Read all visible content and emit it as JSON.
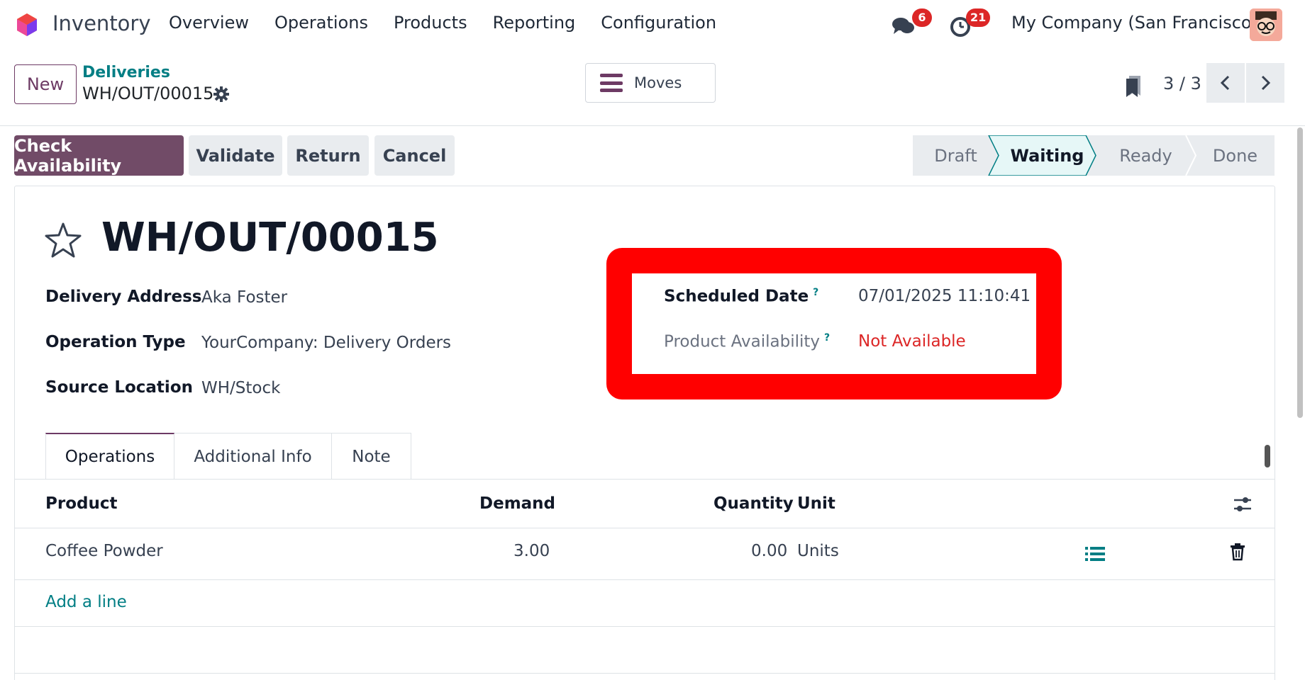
{
  "navbar": {
    "app_name": "Inventory",
    "menu": [
      "Overview",
      "Operations",
      "Products",
      "Reporting",
      "Configuration"
    ],
    "messages_badge": "6",
    "activities_badge": "21",
    "company": "My Company (San Francisco)"
  },
  "control_panel": {
    "new_label": "New",
    "breadcrumb_parent": "Deliveries",
    "breadcrumb_current": "WH/OUT/00015",
    "moves_label": "Moves",
    "pager": "3 / 3"
  },
  "actions": {
    "check_availability": "Check Availability",
    "validate": "Validate",
    "return": "Return",
    "cancel": "Cancel"
  },
  "status_stages": [
    "Draft",
    "Waiting",
    "Ready",
    "Done"
  ],
  "active_stage": "Waiting",
  "record": {
    "title": "WH/OUT/00015",
    "fields": [
      {
        "label": "Delivery Address",
        "value": "Aka Foster"
      },
      {
        "label": "Operation Type",
        "value": "YourCompany: Delivery Orders"
      },
      {
        "label": "Source Location",
        "value": "WH/Stock"
      }
    ],
    "scheduled_date_label": "Scheduled Date",
    "scheduled_date_value": "07/01/2025 11:10:41",
    "availability_label": "Product Availability",
    "availability_value": "Not Available",
    "help_mark": "?"
  },
  "tabs": [
    "Operations",
    "Additional Info",
    "Note"
  ],
  "table": {
    "headers": {
      "product": "Product",
      "demand": "Demand",
      "quantity": "Quantity",
      "unit": "Unit"
    },
    "rows": [
      {
        "product": "Coffee Powder",
        "demand": "3.00",
        "quantity": "0.00",
        "unit": "Units"
      }
    ],
    "add_line": "Add a line"
  },
  "colors": {
    "primary": "#714b67",
    "link": "#017e84",
    "danger": "#dc2626",
    "highlight": "#ff0000"
  }
}
